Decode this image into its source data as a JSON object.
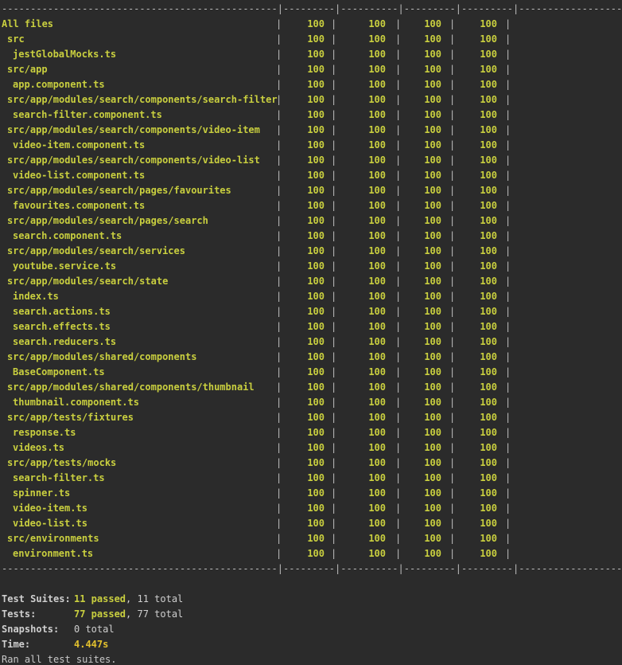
{
  "separator": {
    "line": "------------------------------------------------|---------|----------|---------|---------|-------------------"
  },
  "rows": [
    {
      "name": "All files",
      "indent": 0,
      "stmts": "100",
      "branch": "100",
      "funcs": "100",
      "lines": "100"
    },
    {
      "name": "src",
      "indent": 1,
      "stmts": "100",
      "branch": "100",
      "funcs": "100",
      "lines": "100"
    },
    {
      "name": "jestGlobalMocks.ts",
      "indent": 2,
      "stmts": "100",
      "branch": "100",
      "funcs": "100",
      "lines": "100"
    },
    {
      "name": "src/app",
      "indent": 1,
      "stmts": "100",
      "branch": "100",
      "funcs": "100",
      "lines": "100"
    },
    {
      "name": "app.component.ts",
      "indent": 2,
      "stmts": "100",
      "branch": "100",
      "funcs": "100",
      "lines": "100"
    },
    {
      "name": "src/app/modules/search/components/search-filter",
      "indent": 1,
      "stmts": "100",
      "branch": "100",
      "funcs": "100",
      "lines": "100"
    },
    {
      "name": "search-filter.component.ts",
      "indent": 2,
      "stmts": "100",
      "branch": "100",
      "funcs": "100",
      "lines": "100"
    },
    {
      "name": "src/app/modules/search/components/video-item",
      "indent": 1,
      "stmts": "100",
      "branch": "100",
      "funcs": "100",
      "lines": "100"
    },
    {
      "name": "video-item.component.ts",
      "indent": 2,
      "stmts": "100",
      "branch": "100",
      "funcs": "100",
      "lines": "100"
    },
    {
      "name": "src/app/modules/search/components/video-list",
      "indent": 1,
      "stmts": "100",
      "branch": "100",
      "funcs": "100",
      "lines": "100"
    },
    {
      "name": "video-list.component.ts",
      "indent": 2,
      "stmts": "100",
      "branch": "100",
      "funcs": "100",
      "lines": "100"
    },
    {
      "name": "src/app/modules/search/pages/favourites",
      "indent": 1,
      "stmts": "100",
      "branch": "100",
      "funcs": "100",
      "lines": "100"
    },
    {
      "name": "favourites.component.ts",
      "indent": 2,
      "stmts": "100",
      "branch": "100",
      "funcs": "100",
      "lines": "100"
    },
    {
      "name": "src/app/modules/search/pages/search",
      "indent": 1,
      "stmts": "100",
      "branch": "100",
      "funcs": "100",
      "lines": "100"
    },
    {
      "name": "search.component.ts",
      "indent": 2,
      "stmts": "100",
      "branch": "100",
      "funcs": "100",
      "lines": "100"
    },
    {
      "name": "src/app/modules/search/services",
      "indent": 1,
      "stmts": "100",
      "branch": "100",
      "funcs": "100",
      "lines": "100"
    },
    {
      "name": "youtube.service.ts",
      "indent": 2,
      "stmts": "100",
      "branch": "100",
      "funcs": "100",
      "lines": "100"
    },
    {
      "name": "src/app/modules/search/state",
      "indent": 1,
      "stmts": "100",
      "branch": "100",
      "funcs": "100",
      "lines": "100"
    },
    {
      "name": "index.ts",
      "indent": 2,
      "stmts": "100",
      "branch": "100",
      "funcs": "100",
      "lines": "100"
    },
    {
      "name": "search.actions.ts",
      "indent": 2,
      "stmts": "100",
      "branch": "100",
      "funcs": "100",
      "lines": "100"
    },
    {
      "name": "search.effects.ts",
      "indent": 2,
      "stmts": "100",
      "branch": "100",
      "funcs": "100",
      "lines": "100"
    },
    {
      "name": "search.reducers.ts",
      "indent": 2,
      "stmts": "100",
      "branch": "100",
      "funcs": "100",
      "lines": "100"
    },
    {
      "name": "src/app/modules/shared/components",
      "indent": 1,
      "stmts": "100",
      "branch": "100",
      "funcs": "100",
      "lines": "100"
    },
    {
      "name": "BaseComponent.ts",
      "indent": 2,
      "stmts": "100",
      "branch": "100",
      "funcs": "100",
      "lines": "100"
    },
    {
      "name": "src/app/modules/shared/components/thumbnail",
      "indent": 1,
      "stmts": "100",
      "branch": "100",
      "funcs": "100",
      "lines": "100"
    },
    {
      "name": "thumbnail.component.ts",
      "indent": 2,
      "stmts": "100",
      "branch": "100",
      "funcs": "100",
      "lines": "100"
    },
    {
      "name": "src/app/tests/fixtures",
      "indent": 1,
      "stmts": "100",
      "branch": "100",
      "funcs": "100",
      "lines": "100"
    },
    {
      "name": "response.ts",
      "indent": 2,
      "stmts": "100",
      "branch": "100",
      "funcs": "100",
      "lines": "100"
    },
    {
      "name": "videos.ts",
      "indent": 2,
      "stmts": "100",
      "branch": "100",
      "funcs": "100",
      "lines": "100"
    },
    {
      "name": "src/app/tests/mocks",
      "indent": 1,
      "stmts": "100",
      "branch": "100",
      "funcs": "100",
      "lines": "100"
    },
    {
      "name": "search-filter.ts",
      "indent": 2,
      "stmts": "100",
      "branch": "100",
      "funcs": "100",
      "lines": "100"
    },
    {
      "name": "spinner.ts",
      "indent": 2,
      "stmts": "100",
      "branch": "100",
      "funcs": "100",
      "lines": "100"
    },
    {
      "name": "video-item.ts",
      "indent": 2,
      "stmts": "100",
      "branch": "100",
      "funcs": "100",
      "lines": "100"
    },
    {
      "name": "video-list.ts",
      "indent": 2,
      "stmts": "100",
      "branch": "100",
      "funcs": "100",
      "lines": "100"
    },
    {
      "name": "src/environments",
      "indent": 1,
      "stmts": "100",
      "branch": "100",
      "funcs": "100",
      "lines": "100"
    },
    {
      "name": "environment.ts",
      "indent": 2,
      "stmts": "100",
      "branch": "100",
      "funcs": "100",
      "lines": "100"
    }
  ],
  "summary": {
    "suites_label": "Test Suites:",
    "suites_passed": "11 passed",
    "suites_total": ", 11 total",
    "tests_label": "Tests:",
    "tests_passed": "77 passed",
    "tests_total": ", 77 total",
    "snapshots_label": "Snapshots:",
    "snapshots_value": "0 total",
    "time_label": "Time:",
    "time_value": "4.447s",
    "footer": "Ran all test suites."
  }
}
